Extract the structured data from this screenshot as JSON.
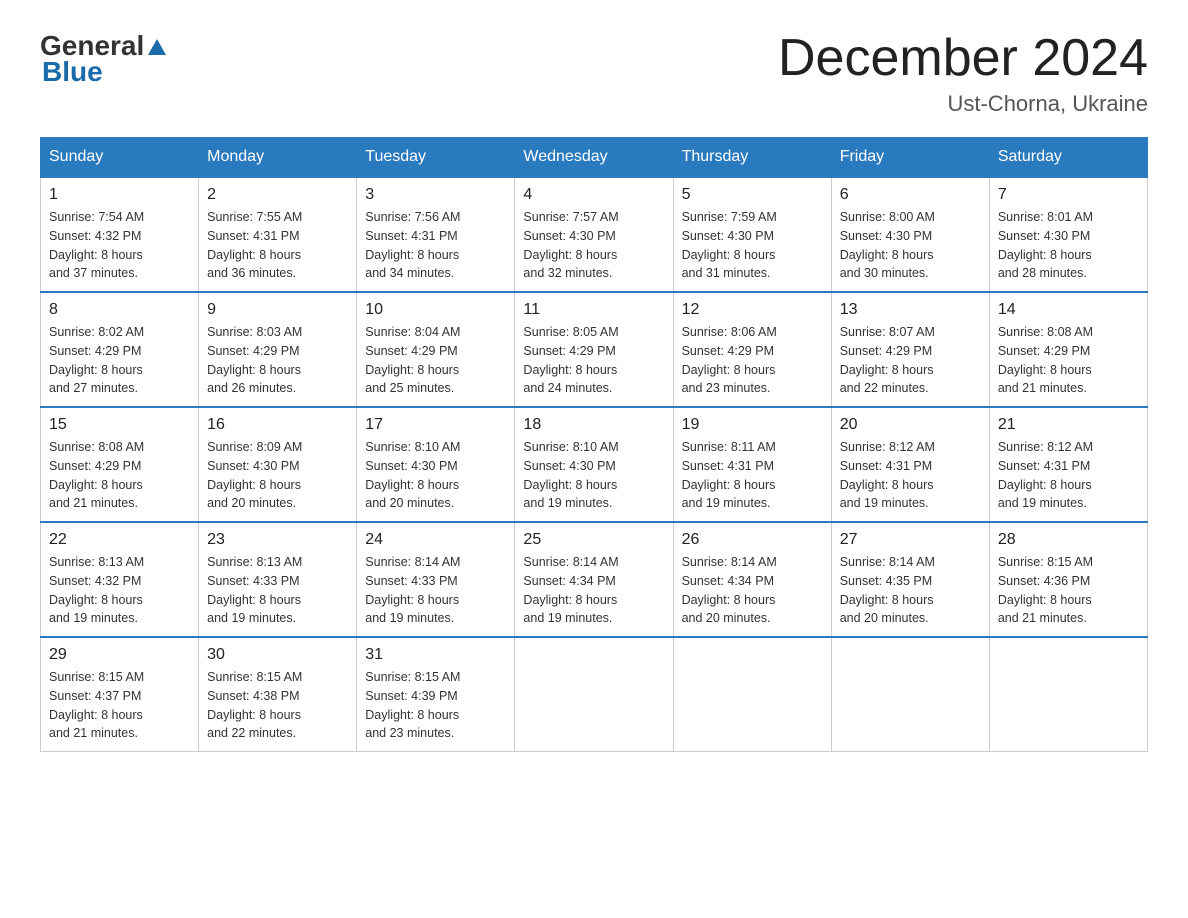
{
  "logo": {
    "general": "General",
    "blue": "Blue"
  },
  "header": {
    "month": "December 2024",
    "location": "Ust-Chorna, Ukraine"
  },
  "days_of_week": [
    "Sunday",
    "Monday",
    "Tuesday",
    "Wednesday",
    "Thursday",
    "Friday",
    "Saturday"
  ],
  "weeks": [
    [
      {
        "day": "1",
        "sunrise": "7:54 AM",
        "sunset": "4:32 PM",
        "daylight": "8 hours and 37 minutes."
      },
      {
        "day": "2",
        "sunrise": "7:55 AM",
        "sunset": "4:31 PM",
        "daylight": "8 hours and 36 minutes."
      },
      {
        "day": "3",
        "sunrise": "7:56 AM",
        "sunset": "4:31 PM",
        "daylight": "8 hours and 34 minutes."
      },
      {
        "day": "4",
        "sunrise": "7:57 AM",
        "sunset": "4:30 PM",
        "daylight": "8 hours and 32 minutes."
      },
      {
        "day": "5",
        "sunrise": "7:59 AM",
        "sunset": "4:30 PM",
        "daylight": "8 hours and 31 minutes."
      },
      {
        "day": "6",
        "sunrise": "8:00 AM",
        "sunset": "4:30 PM",
        "daylight": "8 hours and 30 minutes."
      },
      {
        "day": "7",
        "sunrise": "8:01 AM",
        "sunset": "4:30 PM",
        "daylight": "8 hours and 28 minutes."
      }
    ],
    [
      {
        "day": "8",
        "sunrise": "8:02 AM",
        "sunset": "4:29 PM",
        "daylight": "8 hours and 27 minutes."
      },
      {
        "day": "9",
        "sunrise": "8:03 AM",
        "sunset": "4:29 PM",
        "daylight": "8 hours and 26 minutes."
      },
      {
        "day": "10",
        "sunrise": "8:04 AM",
        "sunset": "4:29 PM",
        "daylight": "8 hours and 25 minutes."
      },
      {
        "day": "11",
        "sunrise": "8:05 AM",
        "sunset": "4:29 PM",
        "daylight": "8 hours and 24 minutes."
      },
      {
        "day": "12",
        "sunrise": "8:06 AM",
        "sunset": "4:29 PM",
        "daylight": "8 hours and 23 minutes."
      },
      {
        "day": "13",
        "sunrise": "8:07 AM",
        "sunset": "4:29 PM",
        "daylight": "8 hours and 22 minutes."
      },
      {
        "day": "14",
        "sunrise": "8:08 AM",
        "sunset": "4:29 PM",
        "daylight": "8 hours and 21 minutes."
      }
    ],
    [
      {
        "day": "15",
        "sunrise": "8:08 AM",
        "sunset": "4:29 PM",
        "daylight": "8 hours and 21 minutes."
      },
      {
        "day": "16",
        "sunrise": "8:09 AM",
        "sunset": "4:30 PM",
        "daylight": "8 hours and 20 minutes."
      },
      {
        "day": "17",
        "sunrise": "8:10 AM",
        "sunset": "4:30 PM",
        "daylight": "8 hours and 20 minutes."
      },
      {
        "day": "18",
        "sunrise": "8:10 AM",
        "sunset": "4:30 PM",
        "daylight": "8 hours and 19 minutes."
      },
      {
        "day": "19",
        "sunrise": "8:11 AM",
        "sunset": "4:31 PM",
        "daylight": "8 hours and 19 minutes."
      },
      {
        "day": "20",
        "sunrise": "8:12 AM",
        "sunset": "4:31 PM",
        "daylight": "8 hours and 19 minutes."
      },
      {
        "day": "21",
        "sunrise": "8:12 AM",
        "sunset": "4:31 PM",
        "daylight": "8 hours and 19 minutes."
      }
    ],
    [
      {
        "day": "22",
        "sunrise": "8:13 AM",
        "sunset": "4:32 PM",
        "daylight": "8 hours and 19 minutes."
      },
      {
        "day": "23",
        "sunrise": "8:13 AM",
        "sunset": "4:33 PM",
        "daylight": "8 hours and 19 minutes."
      },
      {
        "day": "24",
        "sunrise": "8:14 AM",
        "sunset": "4:33 PM",
        "daylight": "8 hours and 19 minutes."
      },
      {
        "day": "25",
        "sunrise": "8:14 AM",
        "sunset": "4:34 PM",
        "daylight": "8 hours and 19 minutes."
      },
      {
        "day": "26",
        "sunrise": "8:14 AM",
        "sunset": "4:34 PM",
        "daylight": "8 hours and 20 minutes."
      },
      {
        "day": "27",
        "sunrise": "8:14 AM",
        "sunset": "4:35 PM",
        "daylight": "8 hours and 20 minutes."
      },
      {
        "day": "28",
        "sunrise": "8:15 AM",
        "sunset": "4:36 PM",
        "daylight": "8 hours and 21 minutes."
      }
    ],
    [
      {
        "day": "29",
        "sunrise": "8:15 AM",
        "sunset": "4:37 PM",
        "daylight": "8 hours and 21 minutes."
      },
      {
        "day": "30",
        "sunrise": "8:15 AM",
        "sunset": "4:38 PM",
        "daylight": "8 hours and 22 minutes."
      },
      {
        "day": "31",
        "sunrise": "8:15 AM",
        "sunset": "4:39 PM",
        "daylight": "8 hours and 23 minutes."
      },
      null,
      null,
      null,
      null
    ]
  ],
  "labels": {
    "sunrise": "Sunrise:",
    "sunset": "Sunset:",
    "daylight": "Daylight:"
  }
}
